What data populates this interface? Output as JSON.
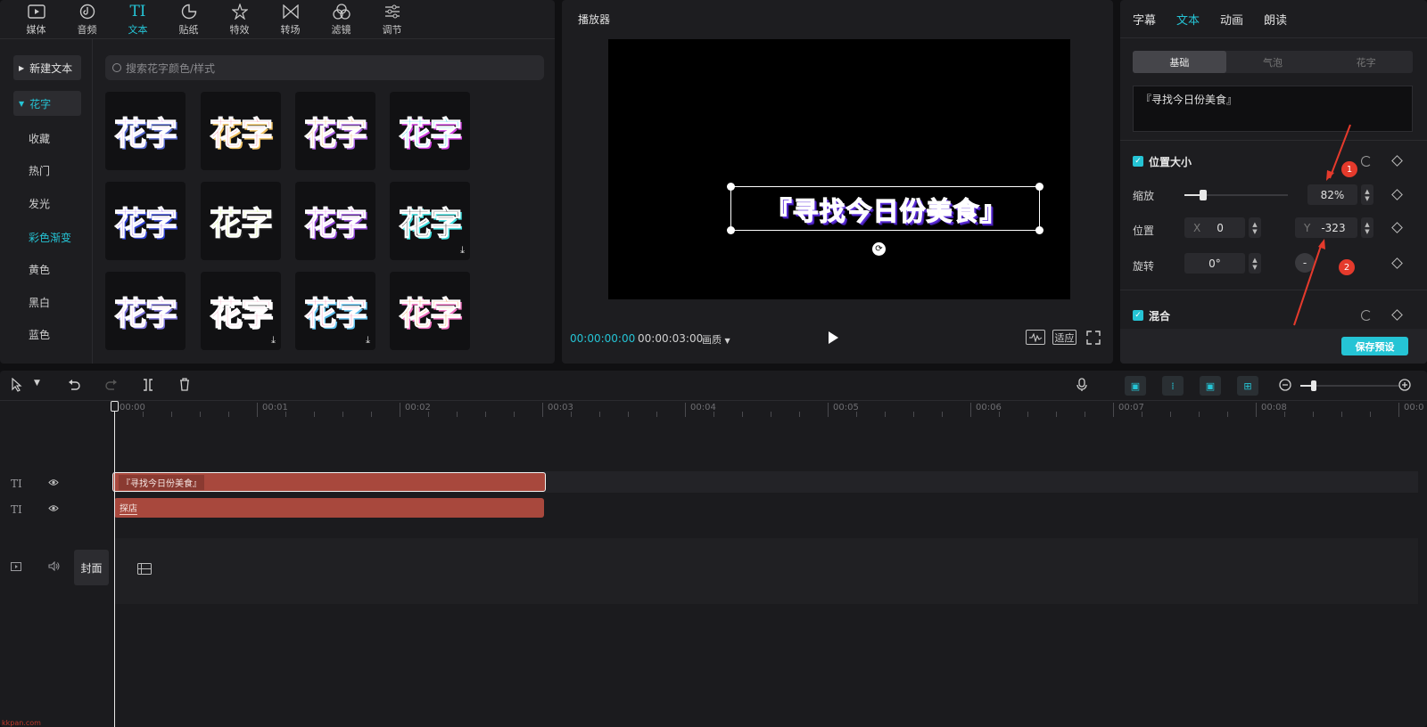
{
  "toolbar": {
    "tabs": [
      {
        "label": "媒体",
        "icon": "media-icon"
      },
      {
        "label": "音频",
        "icon": "audio-icon"
      },
      {
        "label": "文本",
        "icon": "text-icon"
      },
      {
        "label": "贴纸",
        "icon": "sticker-icon"
      },
      {
        "label": "特效",
        "icon": "effects-icon"
      },
      {
        "label": "转场",
        "icon": "transition-icon"
      },
      {
        "label": "滤镜",
        "icon": "filter-icon"
      },
      {
        "label": "调节",
        "icon": "adjust-icon"
      }
    ],
    "text_icon_glyph": "TI"
  },
  "sidebar": {
    "new_text": "新建文本",
    "group": "花字",
    "items": [
      "收藏",
      "热门",
      "发光",
      "彩色渐变",
      "黄色",
      "黑白",
      "蓝色"
    ]
  },
  "search": {
    "placeholder": "搜索花字颜色/样式"
  },
  "gallery": {
    "tile_text": "花字"
  },
  "player": {
    "title": "播放器",
    "video_text": "『寻找今日份美食』",
    "current_time": "00:00:00:00",
    "total_time": "00:00:03:00",
    "quality": "画质",
    "fit": "适应"
  },
  "props": {
    "tabs": [
      "字幕",
      "文本",
      "动画",
      "朗读"
    ],
    "segments": [
      "基础",
      "气泡",
      "花字"
    ],
    "text_content": "『寻找今日份美食』",
    "position_size": "位置大小",
    "scale_label": "缩放",
    "scale_value": "82%",
    "scale_level": 0.18,
    "position_label": "位置",
    "x_prefix": "X",
    "x_value": "0",
    "y_prefix": "Y",
    "y_value": "-323",
    "rotate_label": "旋转",
    "rotate_value": "0°",
    "rotate_dash": "-",
    "blend_label": "混合",
    "save_preset": "保存预设",
    "annotation_1": "1",
    "annotation_2": "2"
  },
  "timeline": {
    "ruler": [
      "00:00",
      "00:01",
      "00:02",
      "00:03",
      "00:04",
      "00:05",
      "00:06",
      "00:07",
      "00:08",
      "00:0"
    ],
    "clip1": "『寻找今日份美食』",
    "clip2": "探店",
    "cover": "封面",
    "lane_text_icon": "TI"
  },
  "watermark": "kkpan.com",
  "colors": {
    "accent": "#25c4d5",
    "clip": "#a8483d",
    "annotation": "#e53a2c"
  }
}
